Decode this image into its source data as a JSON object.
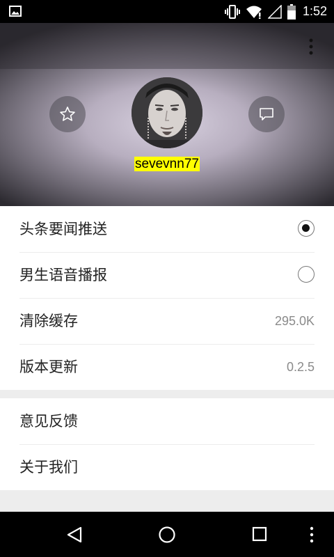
{
  "status_bar": {
    "time": "1:52",
    "icons": [
      "gallery-icon",
      "vibrate-icon",
      "wifi-icon",
      "signal-icon",
      "battery-icon"
    ]
  },
  "profile": {
    "username": "sevevnn77",
    "icons": [
      "star-icon",
      "message-icon",
      "more-vertical-icon"
    ]
  },
  "settings": {
    "group1": [
      {
        "label": "头条要闻推送",
        "type": "radio",
        "checked": true
      },
      {
        "label": "男生语音播报",
        "type": "radio",
        "checked": false
      },
      {
        "label": "清除缓存",
        "type": "value",
        "value": "295.0K"
      },
      {
        "label": "版本更新",
        "type": "value",
        "value": "0.2.5"
      }
    ],
    "group2": [
      {
        "label": "意见反馈"
      },
      {
        "label": "关于我们"
      }
    ]
  },
  "nav_bar": {
    "icons": [
      "back-icon",
      "home-icon",
      "recents-icon",
      "menu-icon"
    ]
  },
  "colors": {
    "username_highlight": "#ffff00",
    "value_text": "#8a8a8a",
    "background": "#ededed"
  }
}
